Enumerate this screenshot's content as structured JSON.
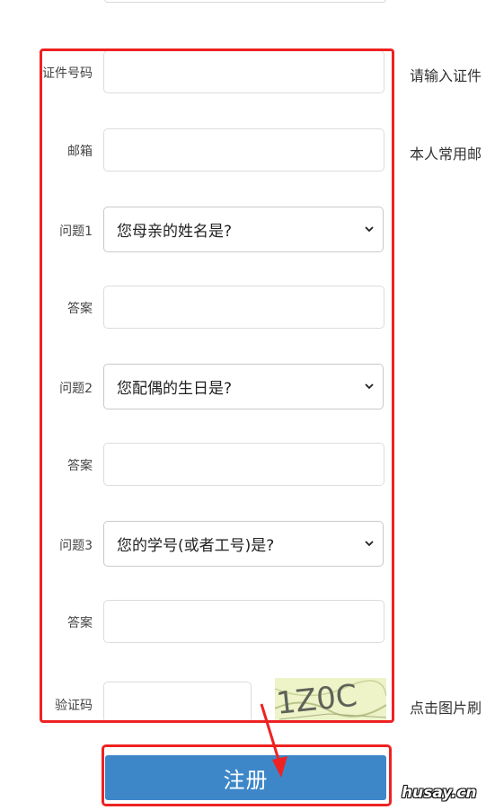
{
  "form": {
    "id_number": {
      "label": "证件号码",
      "hint": "请输入证件"
    },
    "email": {
      "label": "邮箱",
      "hint": "本人常用邮"
    },
    "q1": {
      "label": "问题1",
      "selected": "您母亲的姓名是?"
    },
    "a1": {
      "label": "答案"
    },
    "q2": {
      "label": "问题2",
      "selected": "您配偶的生日是?"
    },
    "a2": {
      "label": "答案"
    },
    "q3": {
      "label": "问题3",
      "selected": "您的学号(或者工号)是?"
    },
    "a3": {
      "label": "答案"
    },
    "captcha": {
      "label": "验证码",
      "image_text": "1Z0C",
      "hint": "点击图片刷"
    }
  },
  "register_label": "注册",
  "watermark": "husay.cn",
  "colors": {
    "annotation": "#ee2222",
    "button": "#3d87c9",
    "captcha_bg": "#eef3c8"
  },
  "icons": {
    "select_arrow": "chevron-down-icon",
    "annotation_arrow": "arrow-icon"
  }
}
